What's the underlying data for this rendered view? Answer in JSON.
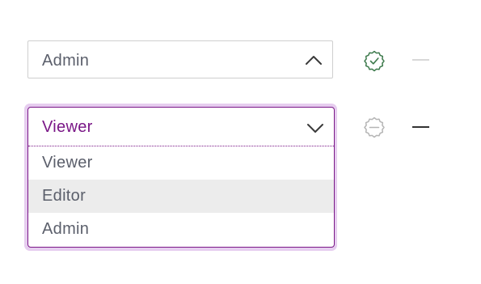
{
  "rows": [
    {
      "selected_value": "Admin",
      "expanded": false,
      "status": "valid",
      "status_color": "#3d7a4c",
      "dash_color": "#d8d8d8"
    },
    {
      "selected_value": "Viewer",
      "expanded": true,
      "status": "neutral",
      "status_color": "#b5b5b5",
      "dash_color": "#333333",
      "options": [
        "Viewer",
        "Editor",
        "Admin"
      ],
      "hovered_option": "Editor"
    }
  ],
  "colors": {
    "accent": "#7a1787",
    "focus_ring": "#e6cdef",
    "text": "#5b5f6b",
    "border": "#cfcfcf",
    "hover_bg": "#ececec"
  }
}
